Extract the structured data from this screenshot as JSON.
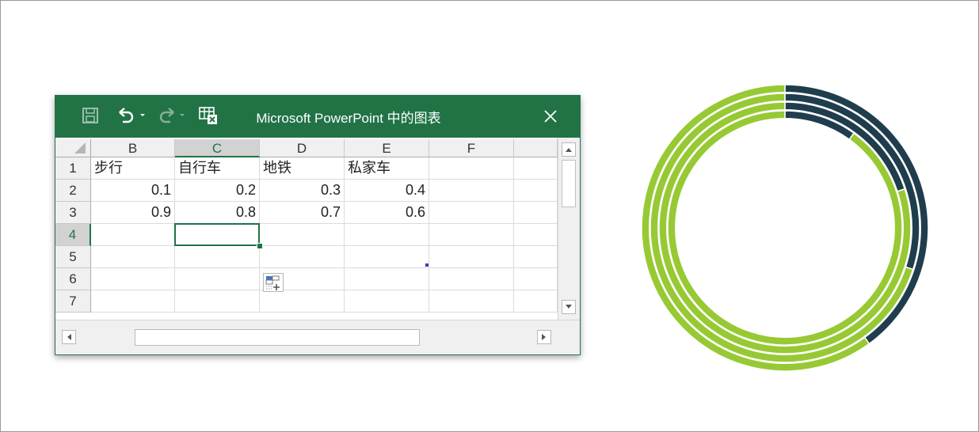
{
  "window": {
    "title": "Microsoft PowerPoint 中的图表",
    "accent": "#217346"
  },
  "icons": {
    "save": "save-icon",
    "undo": "undo-icon",
    "redo": "redo-icon",
    "edit_data": "edit-data-in-excel-icon",
    "close": "close-icon"
  },
  "sheet": {
    "columns": [
      "B",
      "C",
      "D",
      "E",
      "F",
      ""
    ],
    "selected_column": "C",
    "rows": [
      "1",
      "2",
      "3",
      "4",
      "5",
      "6",
      "7"
    ],
    "selected_row": "4",
    "cells": [
      [
        "步行",
        "自行车",
        "地铁",
        "私家车",
        "",
        ""
      ],
      [
        "0.1",
        "0.2",
        "0.3",
        "0.4",
        "",
        ""
      ],
      [
        "0.9",
        "0.8",
        "0.7",
        "0.6",
        "",
        ""
      ],
      [
        "",
        "",
        "",
        "",
        "",
        ""
      ],
      [
        "",
        "",
        "",
        "",
        "",
        ""
      ],
      [
        "",
        "",
        "",
        "",
        "",
        ""
      ],
      [
        "",
        "",
        "",
        "",
        "",
        ""
      ]
    ]
  },
  "chart_data": {
    "type": "donut",
    "categories": [
      "步行",
      "自行车",
      "地铁",
      "私家车"
    ],
    "series": [
      {
        "values": [
          0.1,
          0.9
        ]
      },
      {
        "values": [
          0.2,
          0.8
        ]
      },
      {
        "values": [
          0.3,
          0.7
        ]
      },
      {
        "values": [
          0.4,
          0.6
        ]
      }
    ],
    "colors": {
      "first_point": "#1f3d4d",
      "second_point": "#97c934",
      "separator": "#ffffff"
    },
    "ring_order": "series 1 innermost, series 4 outermost",
    "start_angle": "12 o'clock, clockwise"
  }
}
